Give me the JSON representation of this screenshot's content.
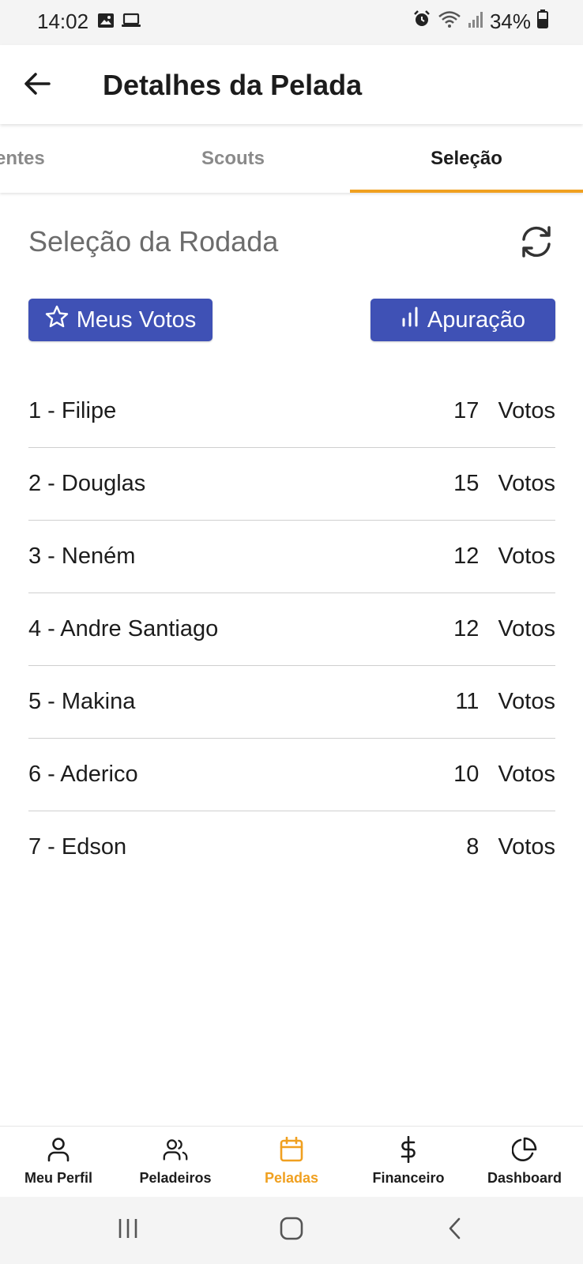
{
  "status_bar": {
    "time": "14:02",
    "battery": "34%",
    "icons": [
      "image-icon",
      "laptop-icon",
      "alarm-icon",
      "wifi-icon",
      "signal-icon",
      "battery-icon"
    ]
  },
  "header": {
    "title": "Detalhes da Pelada",
    "back_icon": "arrow-left-icon"
  },
  "tabs": [
    {
      "label": "entes",
      "active": false
    },
    {
      "label": "Scouts",
      "active": false
    },
    {
      "label": "Seleção",
      "active": true
    }
  ],
  "section": {
    "title": "Seleção da Rodada",
    "refresh_icon": "refresh-icon"
  },
  "buttons": {
    "meus_votos": "Meus Votos",
    "apuracao": "Apuração"
  },
  "ranking": [
    {
      "name": "1 - Filipe",
      "count": "17",
      "unit": "Votos"
    },
    {
      "name": "2 - Douglas",
      "count": "15",
      "unit": "Votos"
    },
    {
      "name": "3 - Neném",
      "count": "12",
      "unit": "Votos"
    },
    {
      "name": "4 - Andre Santiago",
      "count": "12",
      "unit": "Votos"
    },
    {
      "name": "5 - Makina",
      "count": "11",
      "unit": "Votos"
    },
    {
      "name": "6 - Aderico",
      "count": "10",
      "unit": "Votos"
    },
    {
      "name": "7 - Edson",
      "count": "8",
      "unit": "Votos"
    }
  ],
  "bottom_nav": [
    {
      "label": "Meu Perfil",
      "icon": "user-icon",
      "active": false
    },
    {
      "label": "Peladeiros",
      "icon": "users-icon",
      "active": false
    },
    {
      "label": "Peladas",
      "icon": "calendar-icon",
      "active": true
    },
    {
      "label": "Financeiro",
      "icon": "dollar-icon",
      "active": false
    },
    {
      "label": "Dashboard",
      "icon": "pie-chart-icon",
      "active": false
    }
  ],
  "colors": {
    "primary_button": "#3f51b5",
    "accent": "#f0a020",
    "section_title": "#6c6c6c"
  }
}
